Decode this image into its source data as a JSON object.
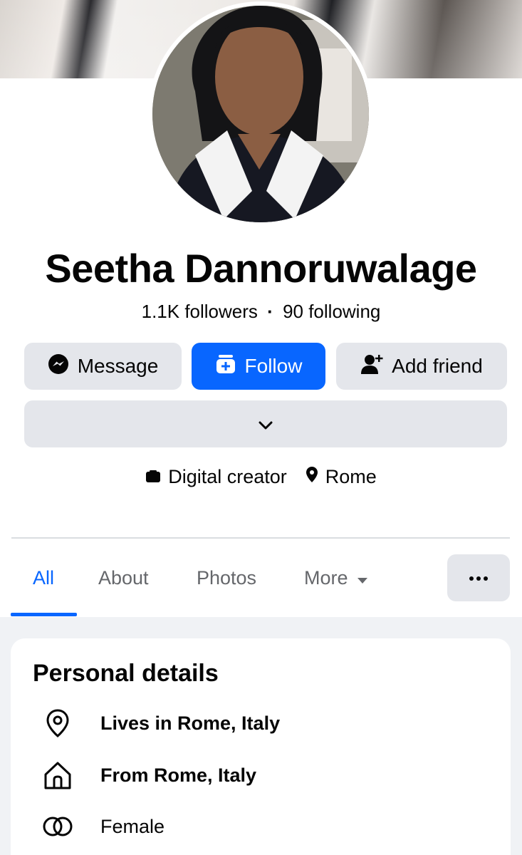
{
  "profile": {
    "name": "Seetha Dannoruwalage",
    "followers": "1.1K followers",
    "separator": "·",
    "following": "90 following"
  },
  "actions": {
    "message_label": "Message",
    "follow_label": "Follow",
    "add_friend_label": "Add friend"
  },
  "intro": {
    "category": "Digital creator",
    "location": "Rome"
  },
  "tabs": [
    {
      "label": "All",
      "active": true
    },
    {
      "label": "About",
      "active": false
    },
    {
      "label": "Photos",
      "active": false
    },
    {
      "label": "More",
      "active": false
    }
  ],
  "personal_details": {
    "title": "Personal details",
    "items": [
      {
        "icon": "location-pin-icon",
        "text": "Lives in Rome, Italy"
      },
      {
        "icon": "home-icon",
        "text": "From Rome, Italy"
      },
      {
        "icon": "gender-icon",
        "text": "Female"
      }
    ]
  },
  "colors": {
    "accent": "#0866ff",
    "button_grey": "#e4e6eb",
    "text_primary": "#050505",
    "text_secondary": "#65676b",
    "page_bg": "#f0f2f5"
  }
}
